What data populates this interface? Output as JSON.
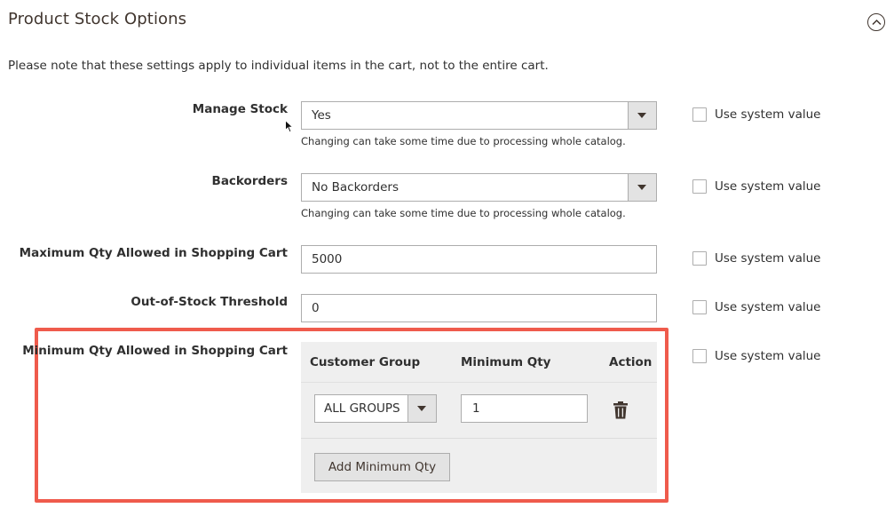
{
  "section": {
    "title": "Product Stock Options",
    "note": "Please note that these settings apply to individual items in the cart, not to the entire cart."
  },
  "fields": {
    "manage_stock": {
      "label": "Manage Stock",
      "value": "Yes",
      "hint": "Changing can take some time due to processing whole catalog.",
      "system_value_label": "Use system value"
    },
    "backorders": {
      "label": "Backorders",
      "value": "No Backorders",
      "hint": "Changing can take some time due to processing whole catalog.",
      "system_value_label": "Use system value"
    },
    "max_qty": {
      "label": "Maximum Qty Allowed in Shopping Cart",
      "value": "5000",
      "system_value_label": "Use system value"
    },
    "out_of_stock": {
      "label": "Out-of-Stock Threshold",
      "value": "0",
      "system_value_label": "Use system value"
    },
    "min_qty": {
      "label": "Minimum Qty Allowed in Shopping Cart",
      "system_value_label": "Use system value",
      "columns": {
        "customer_group": "Customer Group",
        "minimum_qty": "Minimum Qty",
        "action": "Action"
      },
      "rows": [
        {
          "customer_group": "ALL GROUPS",
          "minimum_qty": "1"
        }
      ],
      "add_button": "Add Minimum Qty"
    }
  },
  "colors": {
    "highlight": "#ef5b4c",
    "grid_bg": "#efefef"
  }
}
